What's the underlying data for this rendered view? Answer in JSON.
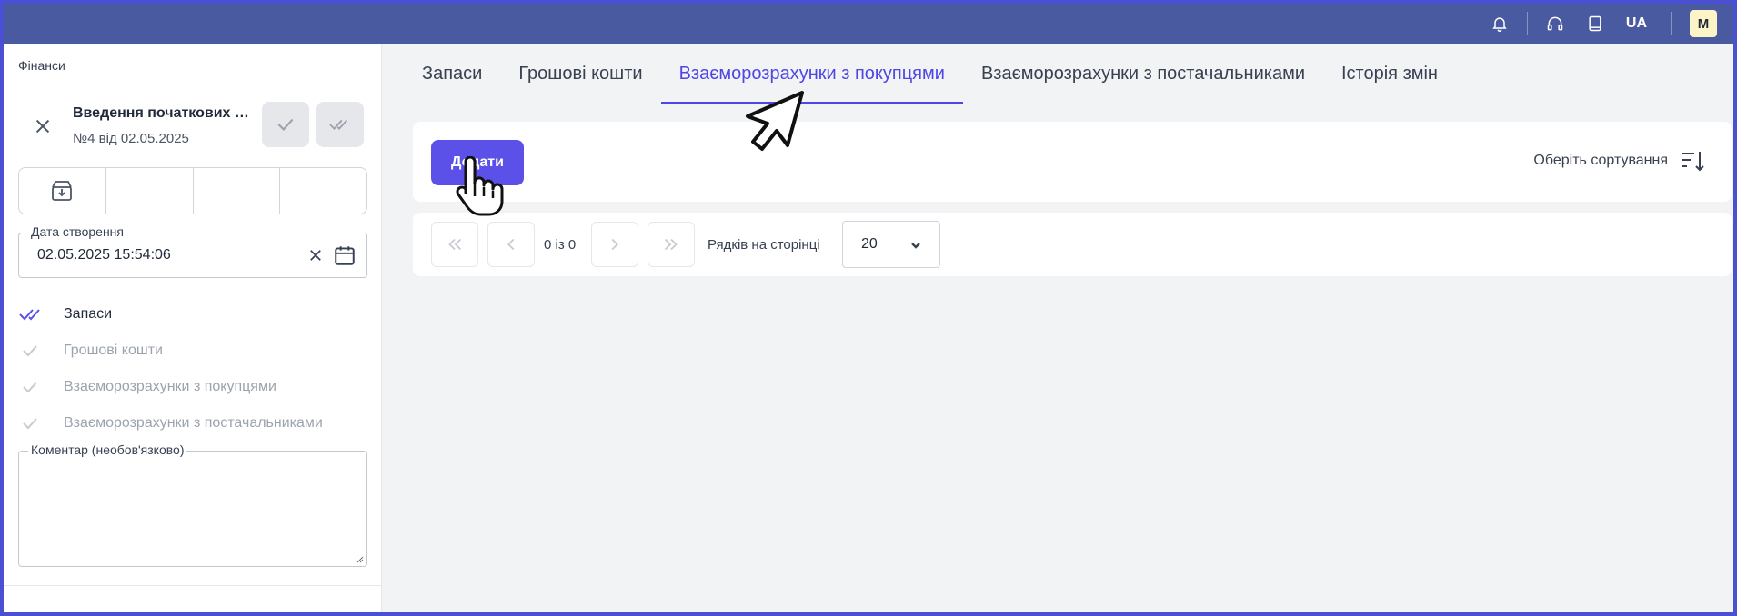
{
  "topbar": {
    "language": "UA",
    "avatar_initial": "M",
    "icons": [
      "bell-icon",
      "headset-icon",
      "book-icon"
    ]
  },
  "sidebar": {
    "section_title": "Фінанси",
    "document": {
      "title": "Введення початкових з...",
      "subtitle": "№4 від 02.05.2025"
    },
    "created_field": {
      "label": "Дата створення",
      "value": "02.05.2025 15:54:06"
    },
    "steps": [
      {
        "label": "Запаси",
        "state": "done"
      },
      {
        "label": "Грошові кошти",
        "state": "pending"
      },
      {
        "label": "Взаєморозрахунки з покупцями",
        "state": "pending"
      },
      {
        "label": "Взаєморозрахунки з постачальниками",
        "state": "pending"
      }
    ],
    "comment": {
      "label": "Коментар (необов'язково)",
      "value": ""
    }
  },
  "tabs": [
    {
      "label": "Запаси",
      "active": false
    },
    {
      "label": "Грошові кошти",
      "active": false
    },
    {
      "label": "Взаєморозрахунки з покупцями",
      "active": true
    },
    {
      "label": "Взаєморозрахунки з постачальниками",
      "active": false
    },
    {
      "label": "Історія змін",
      "active": false
    }
  ],
  "toolbar": {
    "add_label": "Додати",
    "sort_label": "Оберіть сортування"
  },
  "pagination": {
    "count_text": "0 із 0",
    "rows_label": "Рядків на сторінці",
    "rows_per_page": "20"
  },
  "colors": {
    "accent": "#5b50e8",
    "topbar": "#4a5aa0",
    "active_tab": "#4f46e5"
  }
}
